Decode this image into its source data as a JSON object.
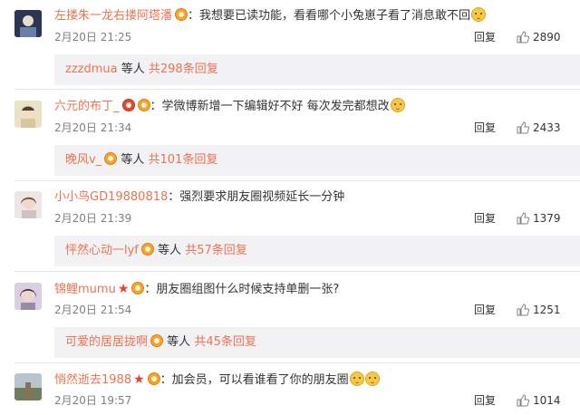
{
  "comments": [
    {
      "user": "左搂朱一龙右搂阿塔潘",
      "content": "我想要已读功能，看看哪个小兔崽子看了消息敢不回",
      "time": "2月20日 21:25",
      "likes": "2890",
      "reply_label": "回复",
      "sub_user": "zzzdmua",
      "sub_wait": "等人",
      "sub_count": "共298条回复"
    },
    {
      "user": "六元的布丁_",
      "content": "学微博新增一下编辑好不好 每次发完都想改",
      "time": "2月20日 21:34",
      "likes": "2433",
      "reply_label": "回复",
      "sub_user": "晚风v_",
      "sub_wait": "等人",
      "sub_count": "共101条回复"
    },
    {
      "user": "小小鸟GD19880818",
      "content": "强烈要求朋友圈视频延长一分钟",
      "time": "2月20日 21:39",
      "likes": "1379",
      "reply_label": "回复",
      "sub_user": "怦然心动一lyf",
      "sub_wait": "等人",
      "sub_count": "共57条回复"
    },
    {
      "user": "锦鲤mumu",
      "content": "朋友圈组图什么时候支持单删一张?",
      "time": "2月20日 21:54",
      "likes": "1251",
      "reply_label": "回复",
      "sub_user": "可爱的居居拢啊",
      "sub_wait": "等人",
      "sub_count": "共45条回复"
    },
    {
      "user": "悄然逝去1988",
      "content": "加会员，可以看谁看了你的朋友圈",
      "time": "2月20日 19:57",
      "likes": "1014",
      "reply_label": "回复"
    }
  ],
  "colon": "：",
  "colors": {
    "username": "#eb7350",
    "meta": "#808080",
    "sub_bg": "#f2f2f5"
  },
  "icons": {
    "like": "thumbs-up-icon",
    "badge": "member-badge-icon",
    "star": "star-icon",
    "emoji": "emoji-face-icon"
  }
}
